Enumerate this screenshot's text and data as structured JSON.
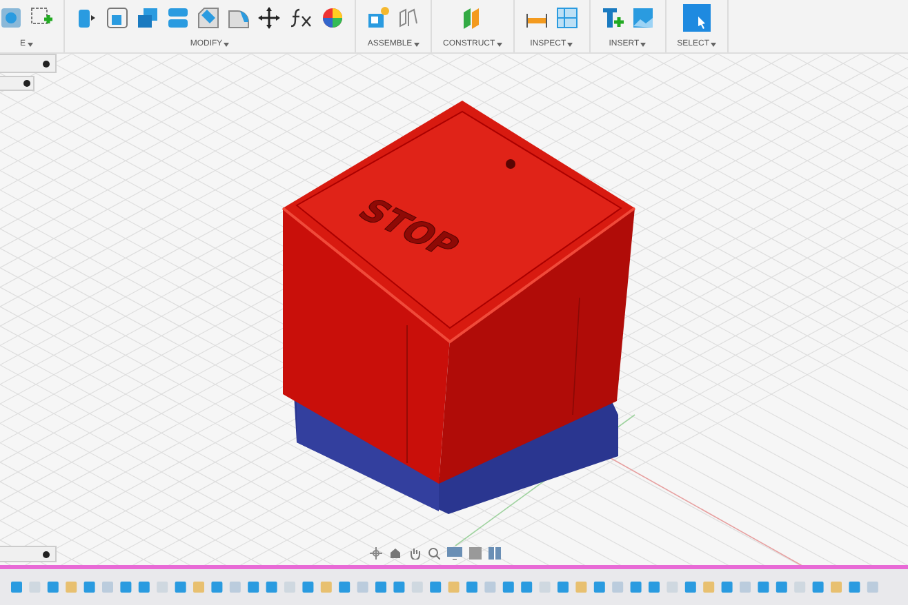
{
  "toolbar": {
    "groups": [
      {
        "label": "E",
        "tools": [
          {
            "kind": "sketch-view"
          },
          {
            "kind": "create-sketch"
          }
        ]
      },
      {
        "label": "MODIFY",
        "tools": [
          {
            "kind": "press-pull"
          },
          {
            "kind": "fillet"
          },
          {
            "kind": "combine"
          },
          {
            "kind": "split"
          },
          {
            "kind": "chamfer"
          },
          {
            "kind": "shell"
          },
          {
            "kind": "move"
          },
          {
            "kind": "parameters"
          },
          {
            "kind": "appearance"
          }
        ]
      },
      {
        "label": "ASSEMBLE",
        "tools": [
          {
            "kind": "new-component"
          },
          {
            "kind": "joint"
          }
        ]
      },
      {
        "label": "CONSTRUCT",
        "tools": [
          {
            "kind": "plane"
          }
        ]
      },
      {
        "label": "INSPECT",
        "tools": [
          {
            "kind": "measure"
          },
          {
            "kind": "section"
          }
        ]
      },
      {
        "label": "INSERT",
        "tools": [
          {
            "kind": "insert"
          },
          {
            "kind": "decal"
          }
        ]
      },
      {
        "label": "SELECT",
        "tools": [
          {
            "kind": "select"
          }
        ]
      }
    ]
  },
  "model": {
    "engraving": "STOP"
  }
}
